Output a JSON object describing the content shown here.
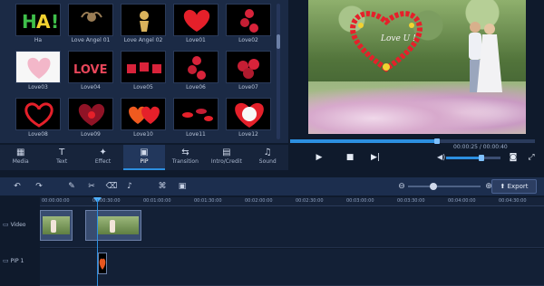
{
  "library": {
    "items": [
      {
        "label": "Ha",
        "style": "ha"
      },
      {
        "label": "Love Angel 01",
        "style": "angel"
      },
      {
        "label": "Love Angel 02",
        "style": "angel2"
      },
      {
        "label": "Love01",
        "style": "heart-red"
      },
      {
        "label": "Love02",
        "style": "roses"
      },
      {
        "label": "Love03",
        "style": "heart-pink"
      },
      {
        "label": "Love04",
        "style": "love-text"
      },
      {
        "label": "Love05",
        "style": "cards"
      },
      {
        "label": "Love06",
        "style": "roses"
      },
      {
        "label": "Love07",
        "style": "rose-bunch"
      },
      {
        "label": "Love08",
        "style": "heart-ring"
      },
      {
        "label": "Love09",
        "style": "heart-petals"
      },
      {
        "label": "Love10",
        "style": "heart-pair"
      },
      {
        "label": "Love11",
        "style": "petals"
      },
      {
        "label": "Love12",
        "style": "kiss-me"
      }
    ]
  },
  "tabs": [
    {
      "label": "Media",
      "icon": "film-icon"
    },
    {
      "label": "Text",
      "icon": "text-icon"
    },
    {
      "label": "Effect",
      "icon": "magic-wand-icon"
    },
    {
      "label": "PIP",
      "icon": "pip-icon",
      "active": true
    },
    {
      "label": "Transition",
      "icon": "transition-icon"
    },
    {
      "label": "Intro/Credit",
      "icon": "clapper-icon"
    },
    {
      "label": "Sound",
      "icon": "headphones-icon"
    }
  ],
  "preview": {
    "overlay_text": "Love U !",
    "timecode": "00:00:25 / 00:00:40"
  },
  "player": {
    "progress_fraction": 0.6,
    "volume_fraction": 0.65
  },
  "toolbar": {
    "export_label": "Export",
    "zoom_fraction": 0.35
  },
  "ruler": {
    "ticks": [
      "00:00:00:00",
      "00:00:30:00",
      "00:01:00:00",
      "00:01:30:00",
      "00:02:00:00",
      "00:02:30:00",
      "00:03:00:00",
      "00:03:30:00",
      "00:04:00:00",
      "00:04:30:00"
    ]
  },
  "tracks": {
    "video_label": "Video",
    "pip_label": "PIP 1"
  },
  "colors": {
    "accent": "#2c8fe0",
    "panel": "#1b2a45",
    "background": "#0f1a2c"
  }
}
